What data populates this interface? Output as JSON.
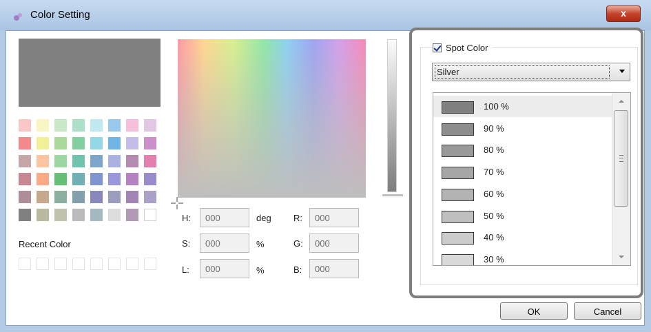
{
  "window": {
    "title": "Color Setting",
    "close_glyph": "x",
    "icon": "app-color-icon"
  },
  "palette": {
    "preview_color": "#808080",
    "colors": [
      [
        "#fbc6c6",
        "#f9f5c2",
        "#c9e8c8",
        "#ace0c8",
        "#c0e8f0",
        "#99c8ed",
        "#f6c0dc",
        "#e3c6e3"
      ],
      [
        "#f4898b",
        "#f1ef97",
        "#a9d99b",
        "#82cfa0",
        "#94d8e6",
        "#71b4e8",
        "#c6bde6",
        "#cb90c9"
      ],
      [
        "#c4a6a6",
        "#fcc4a0",
        "#9cd6a0",
        "#6fc4b0",
        "#7ea5cb",
        "#a9b2e0",
        "#b48ab0",
        "#e47fb0"
      ],
      [
        "#c88692",
        "#fcaa84",
        "#66bf74",
        "#6fb0b4",
        "#8094cf",
        "#9a98dc",
        "#b482c0",
        "#9a8ccc"
      ],
      [
        "#ae8c98",
        "#c8a88c",
        "#8cb0a0",
        "#82a0ac",
        "#8888bc",
        "#9c9cbc",
        "#a484b4",
        "#aaa0c8"
      ],
      [
        "#808080",
        "#b9b9a0",
        "#c0c0ae",
        "#bbbbbb",
        "#a3b8bf",
        "#dcdcdc",
        "#b29ab6",
        "#ffffff"
      ]
    ],
    "recent_label": "Recent Color",
    "recent_count": 8
  },
  "fields": {
    "h": {
      "label": "H:",
      "value": "000",
      "unit": "deg"
    },
    "s": {
      "label": "S:",
      "value": "000",
      "unit": "%"
    },
    "l": {
      "label": "L:",
      "value": "000",
      "unit": "%"
    },
    "r": {
      "label": "R:",
      "value": "000"
    },
    "g": {
      "label": "G:",
      "value": "000"
    },
    "b": {
      "label": "B:",
      "value": "000"
    }
  },
  "spot": {
    "checkbox_label": "Spot Color",
    "checked": true,
    "selected_name": "Silver",
    "items": [
      {
        "label": "100 %",
        "color": "#808080",
        "selected": true
      },
      {
        "label": "90 %",
        "color": "#8d8d8d"
      },
      {
        "label": "80 %",
        "color": "#999999"
      },
      {
        "label": "70 %",
        "color": "#a6a6a6"
      },
      {
        "label": "60 %",
        "color": "#b3b3b3"
      },
      {
        "label": "50 %",
        "color": "#bfbfbf"
      },
      {
        "label": "40 %",
        "color": "#cccccc"
      },
      {
        "label": "30 %",
        "color": "#d9d9d9"
      }
    ]
  },
  "buttons": {
    "ok": "OK",
    "cancel": "Cancel"
  }
}
